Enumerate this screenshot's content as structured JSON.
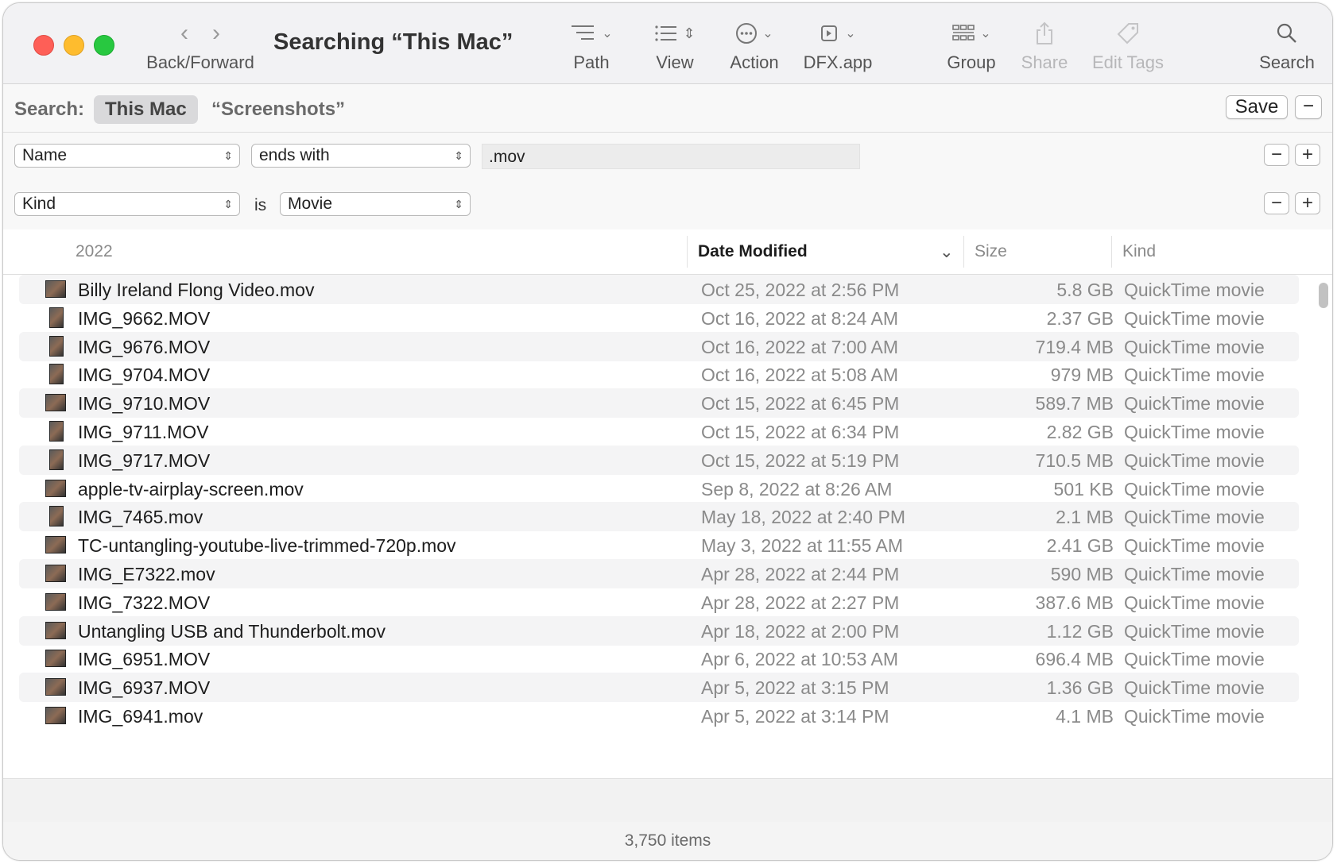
{
  "window": {
    "title": "Searching “This Mac”"
  },
  "toolbar": {
    "back_forward_label": "Back/Forward",
    "path_label": "Path",
    "view_label": "View",
    "action_label": "Action",
    "dfx_label": "DFX.app",
    "group_label": "Group",
    "share_label": "Share",
    "edit_tags_label": "Edit Tags",
    "search_label": "Search"
  },
  "scope": {
    "label": "Search:",
    "this_mac": "This Mac",
    "screenshots": "“Screenshots”",
    "save_label": "Save",
    "minus_label": "−"
  },
  "criteria": [
    {
      "attribute": "Name",
      "operator": "ends with",
      "value": ".mov"
    },
    {
      "attribute": "Kind",
      "operator_text": "is",
      "value": "Movie"
    }
  ],
  "controls": {
    "minus": "−",
    "plus": "+"
  },
  "columns": {
    "group": "2022",
    "date_modified": "Date Modified",
    "size": "Size",
    "kind": "Kind"
  },
  "files": [
    {
      "name": "Billy Ireland Flong Video.mov",
      "date": "Oct 25, 2022 at 2:56 PM",
      "size": "5.8 GB",
      "kind": "QuickTime movie"
    },
    {
      "name": "IMG_9662.MOV",
      "date": "Oct 16, 2022 at 8:24 AM",
      "size": "2.37 GB",
      "kind": "QuickTime movie"
    },
    {
      "name": "IMG_9676.MOV",
      "date": "Oct 16, 2022 at 7:00 AM",
      "size": "719.4 MB",
      "kind": "QuickTime movie"
    },
    {
      "name": "IMG_9704.MOV",
      "date": "Oct 16, 2022 at 5:08 AM",
      "size": "979 MB",
      "kind": "QuickTime movie"
    },
    {
      "name": "IMG_9710.MOV",
      "date": "Oct 15, 2022 at 6:45 PM",
      "size": "589.7 MB",
      "kind": "QuickTime movie"
    },
    {
      "name": "IMG_9711.MOV",
      "date": "Oct 15, 2022 at 6:34 PM",
      "size": "2.82 GB",
      "kind": "QuickTime movie"
    },
    {
      "name": "IMG_9717.MOV",
      "date": "Oct 15, 2022 at 5:19 PM",
      "size": "710.5 MB",
      "kind": "QuickTime movie"
    },
    {
      "name": "apple-tv-airplay-screen.mov",
      "date": "Sep 8, 2022 at 8:26 AM",
      "size": "501 KB",
      "kind": "QuickTime movie"
    },
    {
      "name": "IMG_7465.mov",
      "date": "May 18, 2022 at 2:40 PM",
      "size": "2.1 MB",
      "kind": "QuickTime movie"
    },
    {
      "name": "TC-untangling-youtube-live-trimmed-720p.mov",
      "date": "May 3, 2022 at 11:55 AM",
      "size": "2.41 GB",
      "kind": "QuickTime movie"
    },
    {
      "name": "IMG_E7322.mov",
      "date": "Apr 28, 2022 at 2:44 PM",
      "size": "590 MB",
      "kind": "QuickTime movie"
    },
    {
      "name": "IMG_7322.MOV",
      "date": "Apr 28, 2022 at 2:27 PM",
      "size": "387.6 MB",
      "kind": "QuickTime movie"
    },
    {
      "name": "Untangling USB and Thunderbolt.mov",
      "date": "Apr 18, 2022 at 2:00 PM",
      "size": "1.12 GB",
      "kind": "QuickTime movie"
    },
    {
      "name": "IMG_6951.MOV",
      "date": "Apr 6, 2022 at 10:53 AM",
      "size": "696.4 MB",
      "kind": "QuickTime movie"
    },
    {
      "name": "IMG_6937.MOV",
      "date": "Apr 5, 2022 at 3:15 PM",
      "size": "1.36 GB",
      "kind": "QuickTime movie"
    },
    {
      "name": "IMG_6941.mov",
      "date": "Apr 5, 2022 at 3:14 PM",
      "size": "4.1 MB",
      "kind": "QuickTime movie"
    }
  ],
  "status": {
    "items": "3,750 items"
  },
  "colors": {
    "close": "#fe5f57",
    "minimize": "#febc2e",
    "zoom": "#28c840"
  }
}
